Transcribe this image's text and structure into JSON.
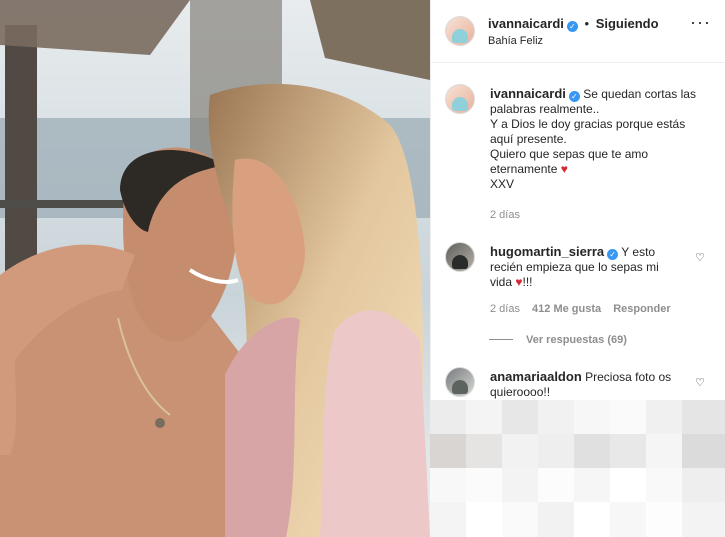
{
  "post": {
    "username": "ivannaicardi",
    "follow_status": "Siguiendo",
    "location": "Bahía Feliz",
    "more_label": "···",
    "caption": {
      "username": "ivannaicardi",
      "text_lines": [
        "Se quedan cortas las",
        "palabras realmente..",
        "Y a Dios le doy gracias porque estás",
        "aquí presente.",
        "Quiero que sepas que te amo",
        "eternamente",
        "XXV"
      ],
      "time": "2 días"
    },
    "comments": [
      {
        "username": "hugomartin_sierra",
        "text_lines": [
          "Y esto",
          "recién empieza que lo sepas mi",
          "vida",
          "!!!"
        ],
        "time": "2 días",
        "likes": "412 Me gusta",
        "reply_label": "Responder",
        "view_replies": "Ver respuestas (69)"
      },
      {
        "username": "anamariaaldon",
        "text_lines": [
          "Preciosa foto os",
          "quieroooo!!"
        ]
      }
    ]
  },
  "colors": {
    "verified": "#3897f0",
    "muted": "#8e8e8e",
    "heart": "#d62935"
  }
}
